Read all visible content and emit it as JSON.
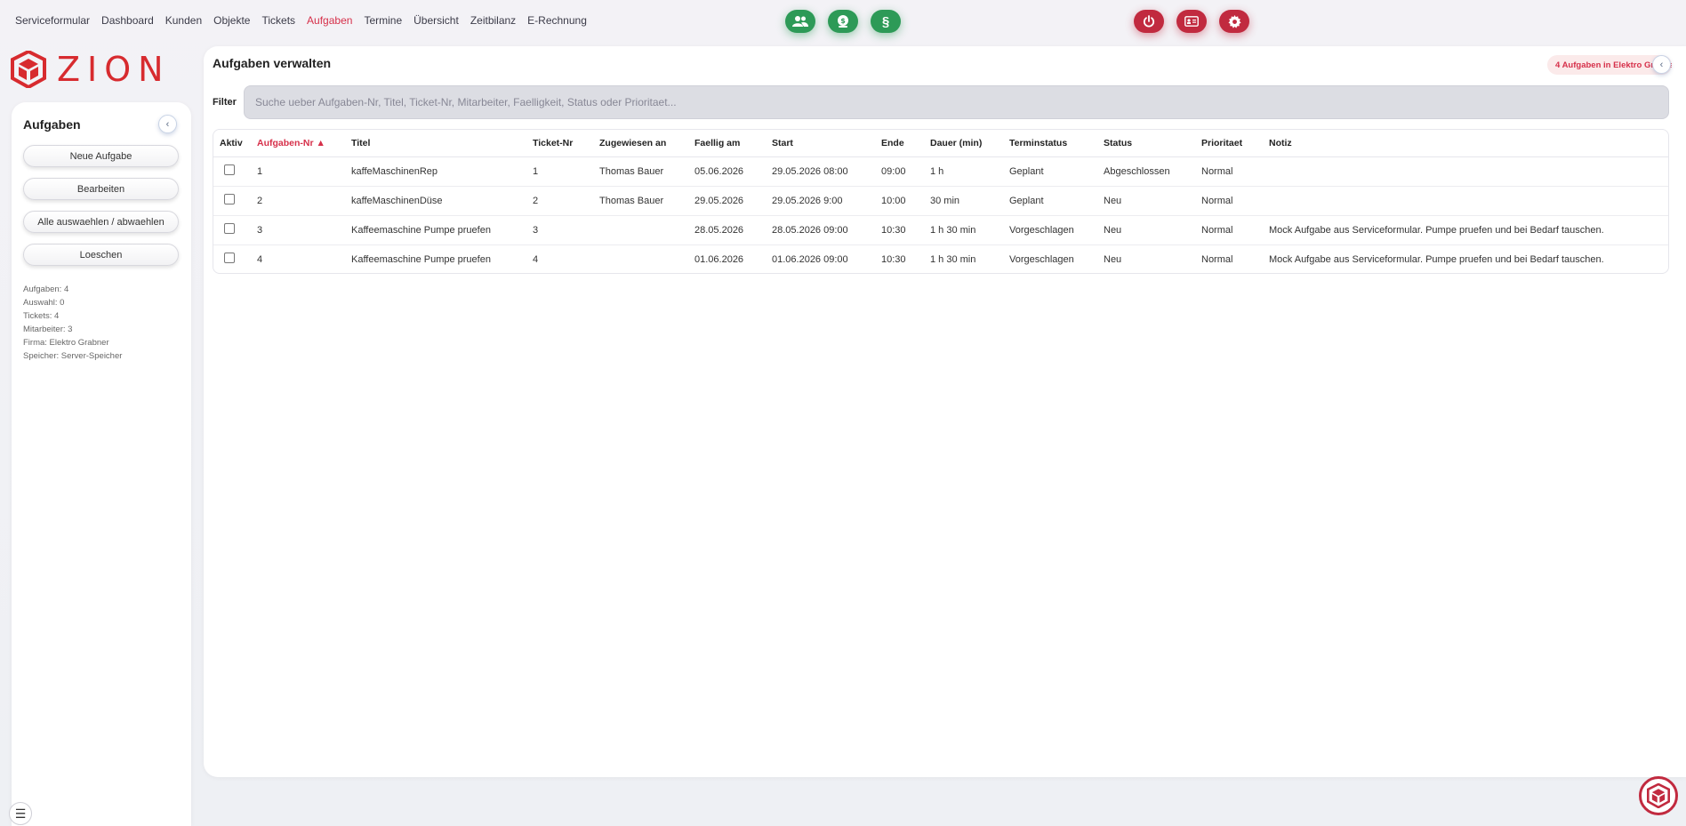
{
  "nav": {
    "items": [
      {
        "label": "Serviceformular",
        "active": false
      },
      {
        "label": "Dashboard",
        "active": false
      },
      {
        "label": "Kunden",
        "active": false
      },
      {
        "label": "Objekte",
        "active": false
      },
      {
        "label": "Tickets",
        "active": false
      },
      {
        "label": "Aufgaben",
        "active": true
      },
      {
        "label": "Termine",
        "active": false
      },
      {
        "label": "Übersicht",
        "active": false
      },
      {
        "label": "Zeitbilanz",
        "active": false
      },
      {
        "label": "E-Rechnung",
        "active": false
      }
    ],
    "icons": {
      "users": "users-icon",
      "money": "money-icon",
      "section_symbol": "§",
      "power": "power-icon",
      "id_card": "id-card-icon",
      "settings": "gear-icon"
    },
    "colors": {
      "green": "#2d9a57",
      "red": "#c12a3f",
      "active": "#d6304a"
    }
  },
  "logo": {
    "text": "ZION"
  },
  "sidebar": {
    "title": "Aufgaben",
    "collapse_symbol": "‹",
    "buttons": {
      "new": "Neue Aufgabe",
      "edit": "Bearbeiten",
      "select_all": "Alle auswaehlen / abwaehlen",
      "delete": "Loeschen"
    },
    "info": [
      "Aufgaben: 4",
      "Auswahl: 0",
      "Tickets: 4",
      "Mitarbeiter: 3",
      "Firma: Elektro Grabner",
      "Speicher: Server-Speicher"
    ],
    "menu_symbol": "☰"
  },
  "main": {
    "title": "Aufgaben verwalten",
    "badge": "4 Aufgaben in Elektro Grabner",
    "filter_label": "Filter",
    "filter_placeholder": "Suche ueber Aufgaben-Nr, Titel, Ticket-Nr, Mitarbeiter, Faelligkeit, Status oder Prioritaet...",
    "columns": [
      "Aktiv",
      "Aufgaben-Nr ▲",
      "Titel",
      "Ticket-Nr",
      "Zugewiesen an",
      "Faellig am",
      "Start",
      "Ende",
      "Dauer (min)",
      "Terminstatus",
      "Status",
      "Prioritaet",
      "Notiz"
    ],
    "rows": [
      {
        "nr": "1",
        "titel": "kaffeMaschinenRep",
        "ticket": "1",
        "zugewiesen": "Thomas Bauer",
        "faellig": "05.06.2026",
        "start": "29.05.2026 08:00",
        "ende": "09:00",
        "dauer": "1 h",
        "terminstatus": "Geplant",
        "status": "Abgeschlossen",
        "prioritaet": "Normal",
        "notiz": ""
      },
      {
        "nr": "2",
        "titel": "kaffeMaschinenDüse",
        "ticket": "2",
        "zugewiesen": "Thomas Bauer",
        "faellig": "29.05.2026",
        "start": "29.05.2026 9:00",
        "ende": "10:00",
        "dauer": "30 min",
        "terminstatus": "Geplant",
        "status": "Neu",
        "prioritaet": "Normal",
        "notiz": ""
      },
      {
        "nr": "3",
        "titel": "Kaffeemaschine Pumpe pruefen",
        "ticket": "3",
        "zugewiesen": "",
        "faellig": "28.05.2026",
        "start": "28.05.2026 09:00",
        "ende": "10:30",
        "dauer": "1 h 30 min",
        "terminstatus": "Vorgeschlagen",
        "status": "Neu",
        "prioritaet": "Normal",
        "notiz": "Mock Aufgabe aus Serviceformular. Pumpe pruefen und bei Bedarf tauschen."
      },
      {
        "nr": "4",
        "titel": "Kaffeemaschine Pumpe pruefen",
        "ticket": "4",
        "zugewiesen": "",
        "faellig": "01.06.2026",
        "start": "01.06.2026 09:00",
        "ende": "10:30",
        "dauer": "1 h 30 min",
        "terminstatus": "Vorgeschlagen",
        "status": "Neu",
        "prioritaet": "Normal",
        "notiz": "Mock Aufgabe aus Serviceformular. Pumpe pruefen und bei Bedarf tauschen."
      }
    ]
  }
}
